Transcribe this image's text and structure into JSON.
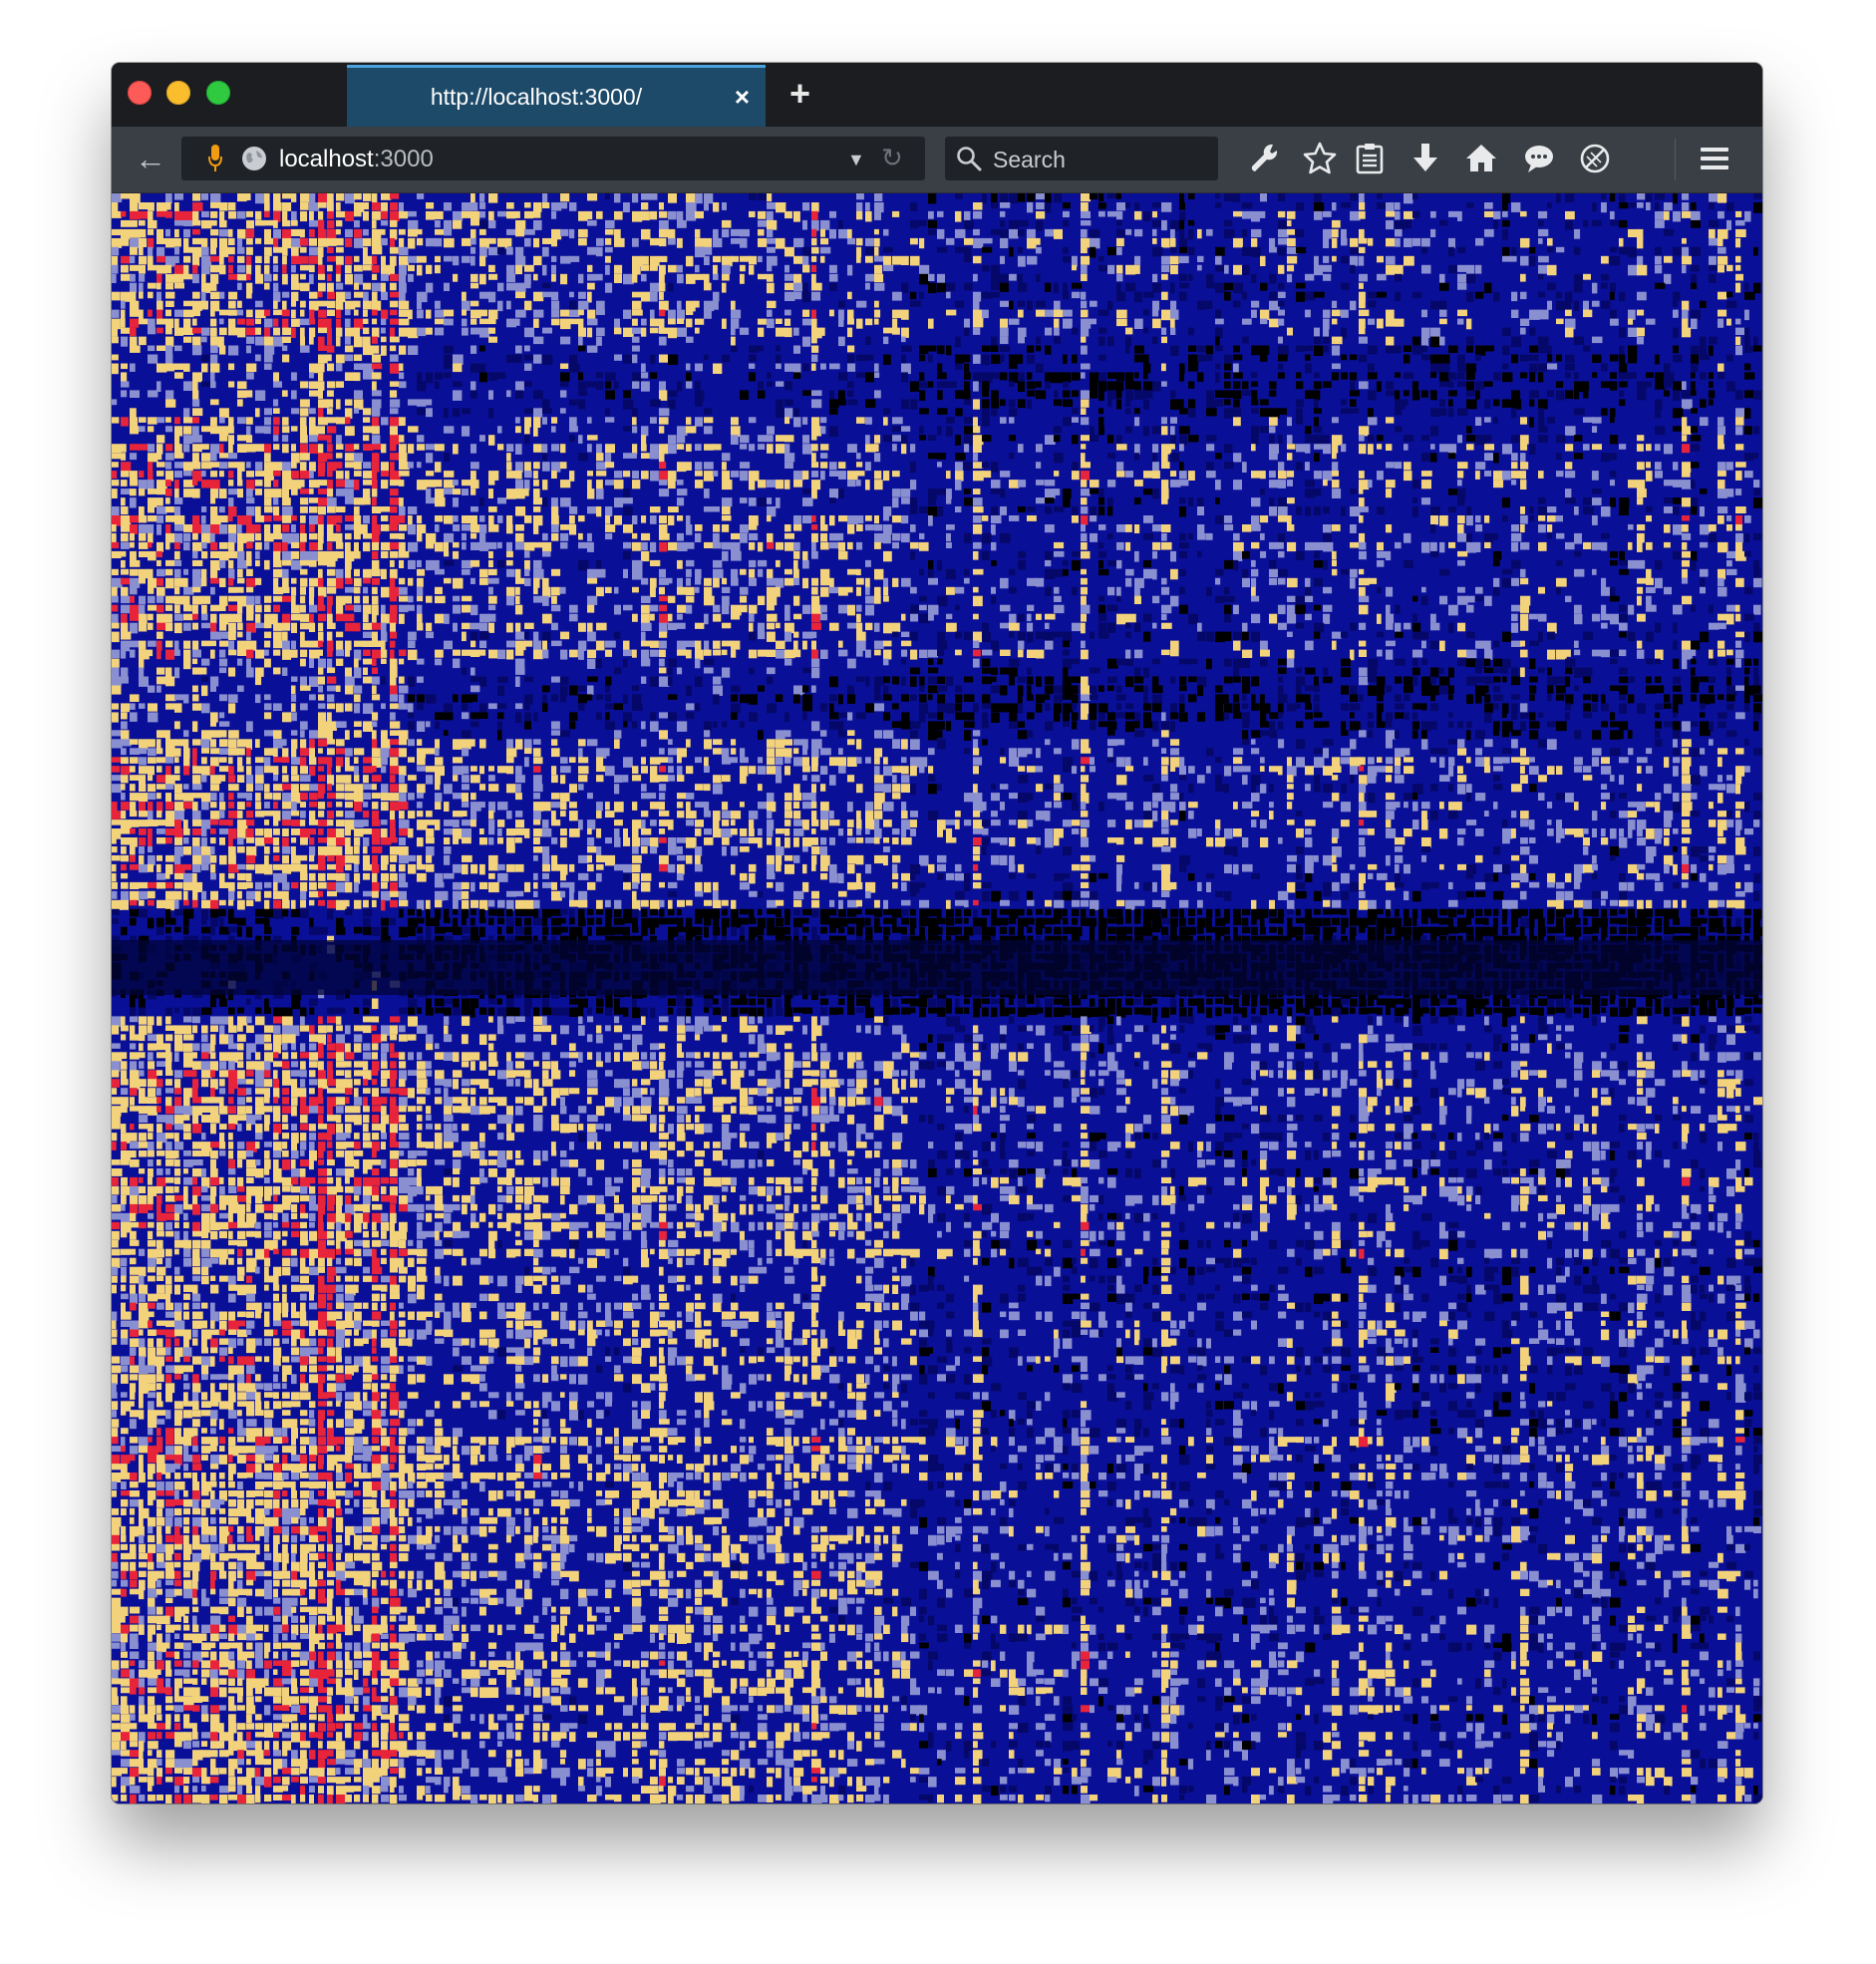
{
  "browser": {
    "tab": {
      "title": "http://localhost:3000/",
      "close_glyph": "×"
    },
    "new_tab_glyph": "+",
    "back_glyph": "←",
    "url": {
      "host": "localhost",
      "port": ":3000",
      "dropdown_glyph": "▼",
      "reload_glyph": "↻"
    },
    "search": {
      "placeholder": "Search"
    },
    "toolbar_icons": [
      "wrench-icon",
      "star-icon",
      "clipboard-icon",
      "download-icon",
      "home-icon",
      "chat-icon",
      "block-icon",
      "menu-icon"
    ]
  },
  "page": {
    "visualization": "spectrogram heatmap",
    "palette": {
      "low": "#000000",
      "mid": "#0a0f98",
      "high": "#f2d27a",
      "peak": "#e8243a"
    }
  }
}
